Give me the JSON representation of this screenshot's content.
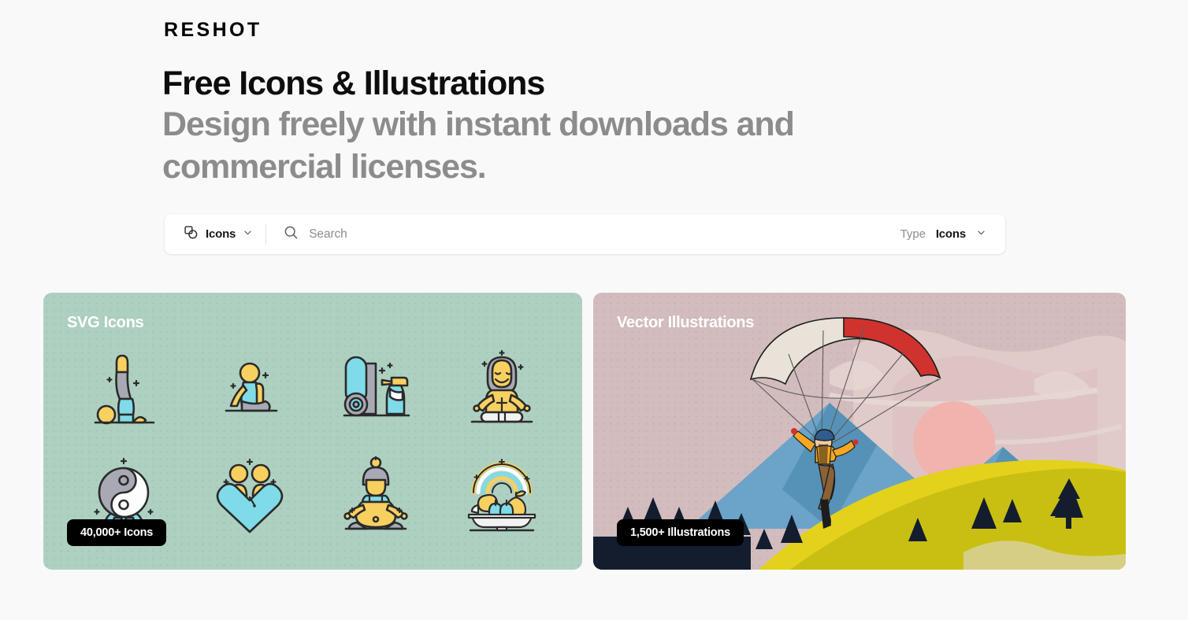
{
  "brand": {
    "logo_text": "RESHOT"
  },
  "hero": {
    "title": "Free Icons & Illustrations",
    "subtitle": "Design freely with instant downloads and commercial licenses."
  },
  "search": {
    "category_icon": "shapes-icon",
    "category_value": "Icons",
    "category_chevron": "chevron-down-icon",
    "search_icon": "search-icon",
    "placeholder": "Search",
    "input_value": "",
    "type_label": "Type",
    "type_value": "Icons",
    "type_chevron": "chevron-down-icon"
  },
  "cards": [
    {
      "id": "svg-icons",
      "title": "SVG Icons",
      "badge": "40,000+ Icons",
      "background_color": "#aed0c1",
      "icons": [
        {
          "name": "yoga-shoulder-stand-icon"
        },
        {
          "name": "yoga-seated-twist-icon"
        },
        {
          "name": "yoga-mat-spray-icon"
        },
        {
          "name": "meditating-guru-icon"
        },
        {
          "name": "yin-yang-lotus-icon"
        },
        {
          "name": "couple-heart-icon"
        },
        {
          "name": "pregnant-meditation-icon"
        },
        {
          "name": "healthy-fruit-bowl-rainbow-icon"
        }
      ]
    },
    {
      "id": "vector-illustrations",
      "title": "Vector Illustrations",
      "badge": "1,500+ Illustrations",
      "background_color": "#d3bcbd",
      "illustration": "paraglider-over-mountains-illustration"
    }
  ],
  "colors": {
    "page_background": "#f9f9f9",
    "text_primary": "#0d0d0d",
    "text_muted": "#8c8c8c",
    "badge_background": "#000000",
    "icon_yellow": "#f7d060",
    "icon_cyan": "#7fdbe8",
    "icon_gray": "#a8a9b4",
    "icon_outline": "#2b2b2b"
  }
}
